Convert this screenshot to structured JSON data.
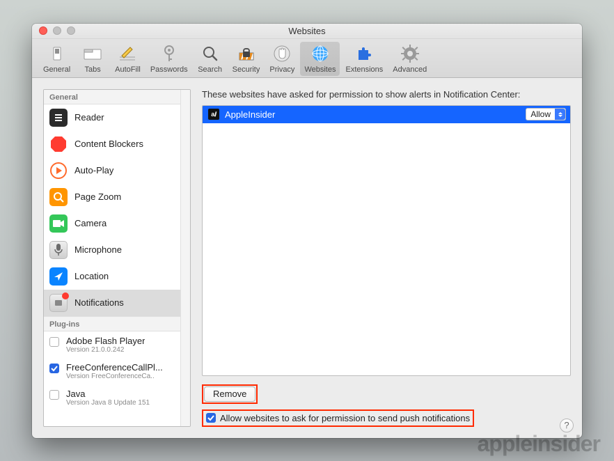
{
  "window": {
    "title": "Websites"
  },
  "toolbar": {
    "items": [
      {
        "label": "General"
      },
      {
        "label": "Tabs"
      },
      {
        "label": "AutoFill"
      },
      {
        "label": "Passwords"
      },
      {
        "label": "Search"
      },
      {
        "label": "Security"
      },
      {
        "label": "Privacy"
      },
      {
        "label": "Websites"
      },
      {
        "label": "Extensions"
      },
      {
        "label": "Advanced"
      }
    ]
  },
  "sidebar": {
    "general_header": "General",
    "items": [
      {
        "label": "Reader"
      },
      {
        "label": "Content Blockers"
      },
      {
        "label": "Auto-Play"
      },
      {
        "label": "Page Zoom"
      },
      {
        "label": "Camera"
      },
      {
        "label": "Microphone"
      },
      {
        "label": "Location"
      },
      {
        "label": "Notifications"
      }
    ],
    "plugins_header": "Plug-ins",
    "plugins": [
      {
        "name": "Adobe Flash Player",
        "version": "Version 21.0.0.242",
        "checked": false
      },
      {
        "name": "FreeConferenceCallPl...",
        "version": "Version FreeConferenceCa..",
        "checked": true
      },
      {
        "name": "Java",
        "version": "Version Java 8 Update 151",
        "checked": false
      }
    ]
  },
  "main": {
    "heading": "These websites have asked for permission to show alerts in Notification Center:",
    "sites": [
      {
        "name": "AppleInsider",
        "permission": "Allow"
      }
    ],
    "remove_label": "Remove",
    "allow_checkbox_label": "Allow websites to ask for permission to send push notifications",
    "allow_checked": true
  },
  "watermark": "appleinsider"
}
